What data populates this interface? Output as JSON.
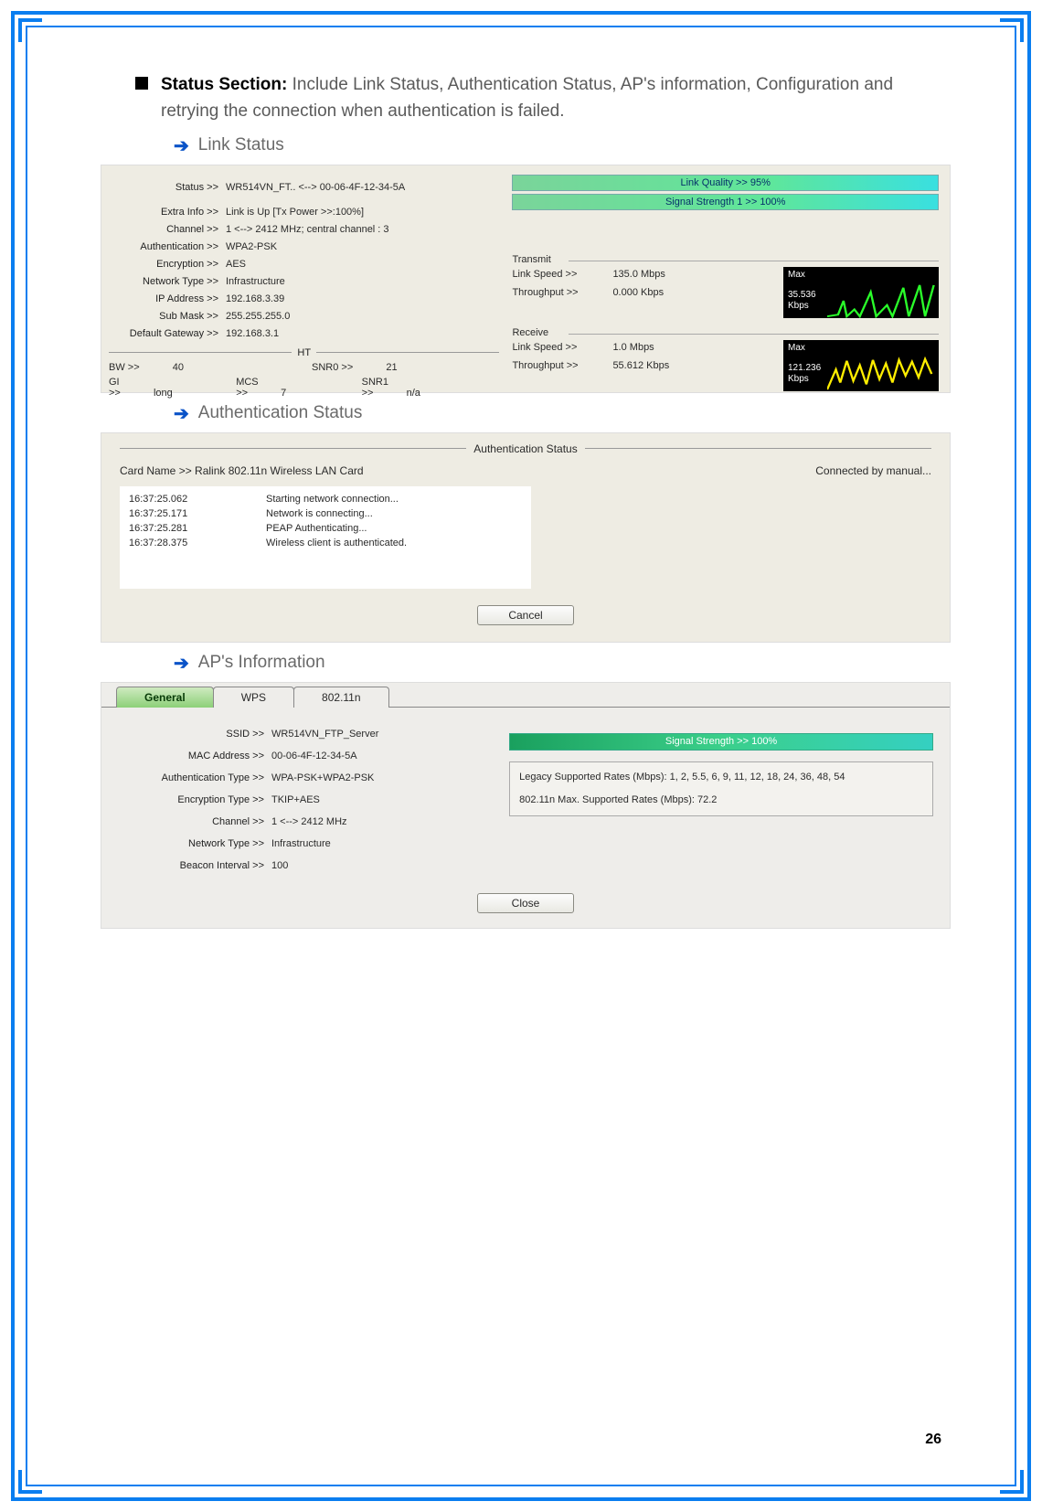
{
  "page_number": "26",
  "bullet": {
    "title": "Status Section:",
    "desc": "Include Link Status, Authentication Status, AP's information, Configuration and retrying the connection when authentication is failed."
  },
  "sub1": "Link Status",
  "sub2": "Authentication Status",
  "sub3": "AP's Information",
  "link_status": {
    "status_k": "Status >>",
    "status_v": "WR514VN_FT.. <--> 00-06-4F-12-34-5A",
    "extra_k": "Extra Info >>",
    "extra_v": "Link is Up [Tx Power >>:100%]",
    "channel_k": "Channel >>",
    "channel_v": "1 <--> 2412 MHz; central channel : 3",
    "auth_k": "Authentication >>",
    "auth_v": "WPA2-PSK",
    "enc_k": "Encryption >>",
    "enc_v": "AES",
    "ntype_k": "Network Type >>",
    "ntype_v": "Infrastructure",
    "ip_k": "IP Address >>",
    "ip_v": "192.168.3.39",
    "mask_k": "Sub Mask >>",
    "mask_v": "255.255.255.0",
    "gw_k": "Default Gateway >>",
    "gw_v": "192.168.3.1",
    "ht_label": "HT",
    "bw_k": "BW >>",
    "bw_v": "40",
    "snr0_k": "SNR0 >>",
    "snr0_v": "21",
    "gi_k": "GI >>",
    "gi_v": "long",
    "mcs_k": "MCS >>",
    "mcs_v": "7",
    "snr1_k": "SNR1 >>",
    "snr1_v": "n/a",
    "lq_bar": "Link Quality >> 95%",
    "ss_bar": "Signal Strength 1 >> 100%",
    "tx_label": "Transmit",
    "tx_ls_k": "Link Speed >>",
    "tx_ls_v": "135.0 Mbps",
    "tx_tp_k": "Throughput >>",
    "tx_tp_v": "0.000 Kbps",
    "tx_max": "Max",
    "tx_rate": "35.536",
    "tx_unit": "Kbps",
    "rx_label": "Receive",
    "rx_ls_k": "Link Speed >>",
    "rx_ls_v": "1.0 Mbps",
    "rx_tp_k": "Throughput >>",
    "rx_tp_v": "55.612 Kbps",
    "rx_max": "Max",
    "rx_rate": "121.236",
    "rx_unit": "Kbps"
  },
  "auth": {
    "title": "Authentication Status",
    "card_k": "Card Name >>",
    "card_v": "Ralink 802.11n Wireless LAN Card",
    "conn": "Connected by manual...",
    "log": [
      {
        "ts": "16:37:25.062",
        "msg": "Starting network connection..."
      },
      {
        "ts": "16:37:25.171",
        "msg": "Network is connecting..."
      },
      {
        "ts": "16:37:25.281",
        "msg": "PEAP Authenticating..."
      },
      {
        "ts": "16:37:28.375",
        "msg": "Wireless client is authenticated."
      }
    ],
    "cancel": "Cancel"
  },
  "ap": {
    "tabs": {
      "general": "General",
      "wps": "WPS",
      "n": "802.11n"
    },
    "ssid_k": "SSID >>",
    "ssid_v": "WR514VN_FTP_Server",
    "mac_k": "MAC Address >>",
    "mac_v": "00-06-4F-12-34-5A",
    "atype_k": "Authentication Type >>",
    "atype_v": "WPA-PSK+WPA2-PSK",
    "etype_k": "Encryption Type >>",
    "etype_v": "TKIP+AES",
    "ch_k": "Channel >>",
    "ch_v": "1 <--> 2412 MHz",
    "nt_k": "Network Type >>",
    "nt_v": "Infrastructure",
    "bi_k": "Beacon Interval >>",
    "bi_v": "100",
    "sig": "Signal Strength >> 100%",
    "rates1": "Legacy Supported Rates (Mbps): 1, 2, 5.5, 6, 9, 11, 12, 18, 24, 36, 48, 54",
    "rates2": "802.11n Max. Supported Rates (Mbps): 72.2",
    "close": "Close"
  }
}
